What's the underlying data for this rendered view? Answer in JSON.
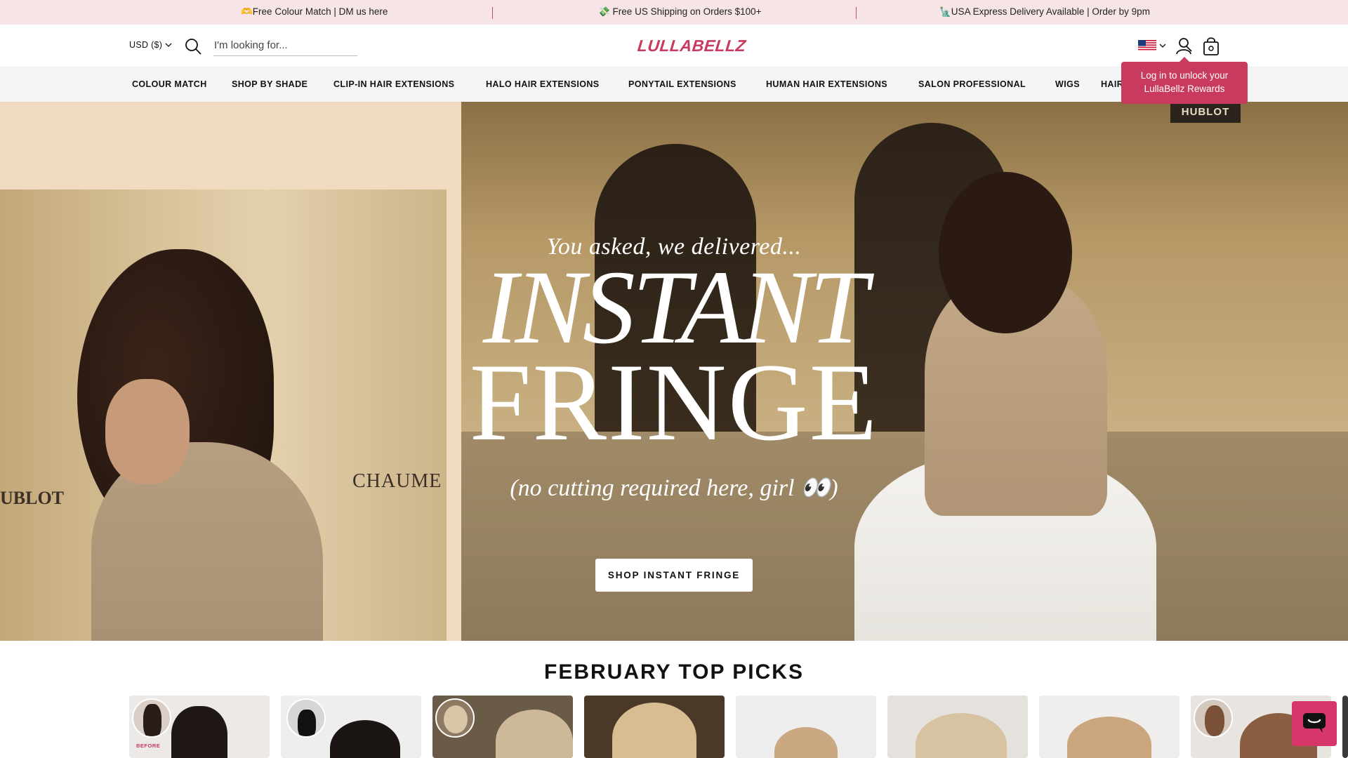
{
  "announcement": {
    "items": [
      {
        "icon": "🫶",
        "text": "🫶Free Colour Match | DM us here"
      },
      {
        "icon": "💸",
        "text": "💸 Free US Shipping on Orders $100+"
      },
      {
        "icon": "🗽",
        "text": "🗽USA Express Delivery Available | Order by 9pm"
      }
    ]
  },
  "header": {
    "currency": "USD ($)",
    "search_placeholder": "I'm looking for...",
    "logo": "LULLABELLZ",
    "tooltip": "Log in to unlock your LullaBellz Rewards"
  },
  "nav": {
    "items": [
      {
        "label": "COLOUR MATCH"
      },
      {
        "label": "SHOP BY SHADE"
      },
      {
        "label": "CLIP-IN HAIR EXTENSIONS"
      },
      {
        "label": "HALO HAIR EXTENSIONS"
      },
      {
        "label": "PONYTAIL EXTENSIONS"
      },
      {
        "label": "HUMAN HAIR EXTENSIONS"
      },
      {
        "label": "SALON PROFESSIONAL"
      },
      {
        "label": "WIGS"
      },
      {
        "label": "HAIR"
      }
    ]
  },
  "hero": {
    "tagline": "You asked, we delivered...",
    "headline_1": "INSTANT",
    "headline_2": "FRINGE",
    "subline": "(no cutting required here, girl 👀)",
    "cta": "SHOP INSTANT FRINGE",
    "left_wall_text": "CHAUME",
    "left_wall_text_2": "UBLOT",
    "right_sign_text": "HUBLOT"
  },
  "section": {
    "title": "FEBRUARY TOP PICKS",
    "before_label": "BEFORE"
  },
  "colors": {
    "brand": "#c83a5e",
    "announce_bg": "#f6e4e6",
    "nav_bg": "#f5f5f5",
    "chat": "#d6366a"
  },
  "icons": [
    "chevron-down-icon",
    "search-icon",
    "us-flag-icon",
    "account-icon",
    "shopping-bag-icon",
    "chat-icon"
  ]
}
